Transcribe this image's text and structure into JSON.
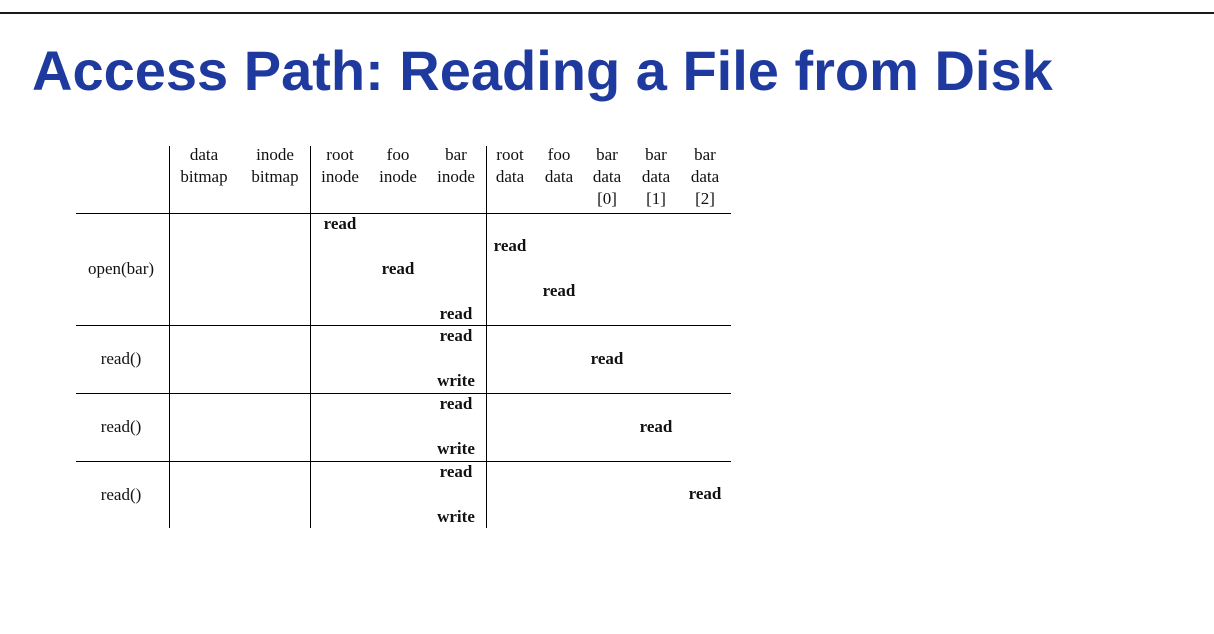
{
  "slide": {
    "title": "Access Path: Reading a File from Disk"
  },
  "table": {
    "columns": [
      {
        "lines": [
          "data",
          "bitmap"
        ]
      },
      {
        "lines": [
          "inode",
          "bitmap"
        ]
      },
      {
        "lines": [
          "root",
          "inode"
        ]
      },
      {
        "lines": [
          "foo",
          "inode"
        ]
      },
      {
        "lines": [
          "bar",
          "inode"
        ]
      },
      {
        "lines": [
          "root",
          "data"
        ]
      },
      {
        "lines": [
          "foo",
          "data"
        ]
      },
      {
        "lines": [
          "bar",
          "data",
          "[0]"
        ]
      },
      {
        "lines": [
          "bar",
          "data",
          "[1]"
        ]
      },
      {
        "lines": [
          "bar",
          "data",
          "[2]"
        ]
      }
    ],
    "rows": [
      {
        "label": "open(bar)",
        "ops": [
          {
            "col": 2,
            "line": 0,
            "text": "read"
          },
          {
            "col": 5,
            "line": 1,
            "text": "read"
          },
          {
            "col": 3,
            "line": 2,
            "text": "read"
          },
          {
            "col": 6,
            "line": 3,
            "text": "read"
          },
          {
            "col": 4,
            "line": 4,
            "text": "read"
          }
        ]
      },
      {
        "label": "read()",
        "ops": [
          {
            "col": 4,
            "line": 0,
            "text": "read"
          },
          {
            "col": 7,
            "line": 1,
            "text": "read"
          },
          {
            "col": 4,
            "line": 2,
            "text": "write"
          }
        ]
      },
      {
        "label": "read()",
        "ops": [
          {
            "col": 4,
            "line": 0,
            "text": "read"
          },
          {
            "col": 8,
            "line": 1,
            "text": "read"
          },
          {
            "col": 4,
            "line": 2,
            "text": "write"
          }
        ]
      },
      {
        "label": "read()",
        "ops": [
          {
            "col": 4,
            "line": 0,
            "text": "read"
          },
          {
            "col": 9,
            "line": 1,
            "text": "read"
          },
          {
            "col": 4,
            "line": 2,
            "text": "write"
          }
        ]
      }
    ]
  }
}
